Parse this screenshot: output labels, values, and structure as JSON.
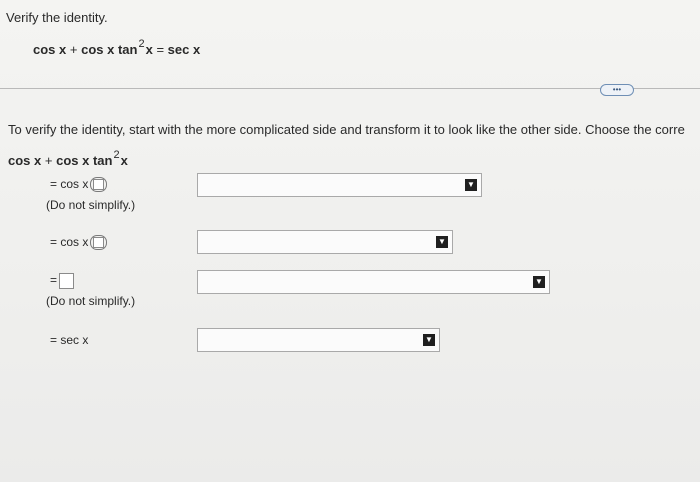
{
  "prompt": "Verify the identity.",
  "identity": {
    "lhs_a": "cos x",
    "plus": "+",
    "lhs_b": "cos x tan",
    "exp": "2",
    "var": "x",
    "eq": "=",
    "rhs": "sec x"
  },
  "more_button": "•••",
  "instructions": "To verify the identity, start with the more complicated side and transform it to look like the other side. Choose the corre",
  "work": {
    "lhs_a": "cos x",
    "plus": "+",
    "lhs_b": "cos x tan",
    "exp": "2",
    "var": "x",
    "step1": "= cos x",
    "note1": "(Do not simplify.)",
    "step2": "= cos x",
    "step3": "=",
    "note3": "(Do not simplify.)",
    "step4": "= sec x"
  },
  "dropdowns": [
    {
      "selected": "",
      "arrow": "▼"
    },
    {
      "selected": "",
      "arrow": "▼"
    },
    {
      "selected": "",
      "arrow": "▼"
    },
    {
      "selected": "",
      "arrow": "▼"
    }
  ]
}
